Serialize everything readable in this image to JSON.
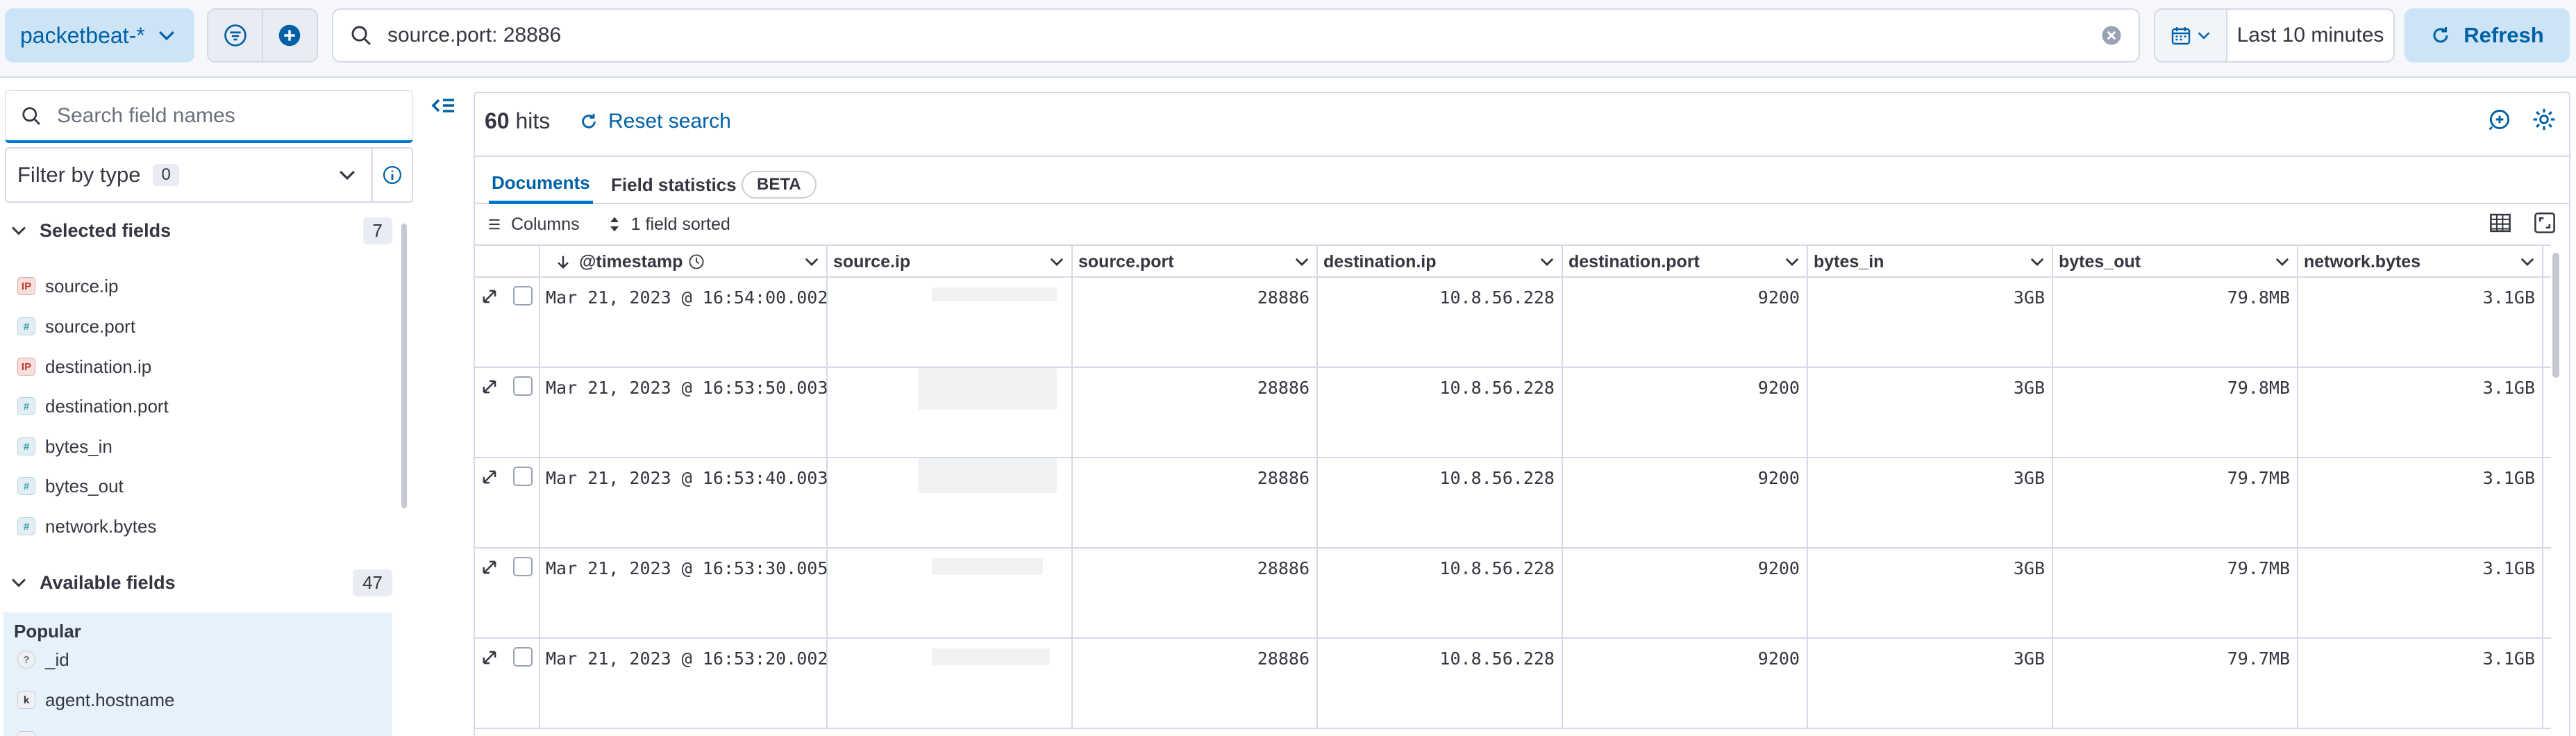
{
  "topbar": {
    "index_pattern": "packetbeat-*",
    "query": "source.port: 28886",
    "time_range": "Last 10 minutes",
    "refresh_label": "Refresh"
  },
  "sidebar": {
    "search_placeholder": "Search field names",
    "filter_by_type_label": "Filter by type",
    "filter_by_type_count": "0",
    "selected_title": "Selected fields",
    "selected_count": "7",
    "selected_fields": [
      {
        "name": "source.ip",
        "type": "ip"
      },
      {
        "name": "source.port",
        "type": "number"
      },
      {
        "name": "destination.ip",
        "type": "ip"
      },
      {
        "name": "destination.port",
        "type": "number"
      },
      {
        "name": "bytes_in",
        "type": "number"
      },
      {
        "name": "bytes_out",
        "type": "number"
      },
      {
        "name": "network.bytes",
        "type": "number"
      }
    ],
    "available_title": "Available fields",
    "available_count": "47",
    "popular_label": "Popular",
    "popular_fields": [
      {
        "name": "_id",
        "type": "unknown"
      },
      {
        "name": "agent.hostname",
        "type": "keyword"
      }
    ]
  },
  "main": {
    "hits_count": "60",
    "hits_label": "hits",
    "reset_label": "Reset search",
    "tabs": [
      "Documents",
      "Field statistics"
    ],
    "beta_badge": "BETA",
    "columns_label": "Columns",
    "sorted_label": "1 field sorted"
  },
  "grid": {
    "columns": [
      "@timestamp",
      "source.ip",
      "source.port",
      "destination.ip",
      "destination.port",
      "bytes_in",
      "bytes_out",
      "network.bytes"
    ],
    "rows": [
      {
        "timestamp": "Mar 21, 2023 @ 16:54:00.002",
        "source_port": "28886",
        "destination_ip": "10.8.56.228",
        "destination_port": "9200",
        "bytes_in": "3GB",
        "bytes_out": "79.8MB",
        "network_bytes": "3.1GB"
      },
      {
        "timestamp": "Mar 21, 2023 @ 16:53:50.003",
        "source_port": "28886",
        "destination_ip": "10.8.56.228",
        "destination_port": "9200",
        "bytes_in": "3GB",
        "bytes_out": "79.8MB",
        "network_bytes": "3.1GB"
      },
      {
        "timestamp": "Mar 21, 2023 @ 16:53:40.003",
        "source_port": "28886",
        "destination_ip": "10.8.56.228",
        "destination_port": "9200",
        "bytes_in": "3GB",
        "bytes_out": "79.7MB",
        "network_bytes": "3.1GB"
      },
      {
        "timestamp": "Mar 21, 2023 @ 16:53:30.005",
        "source_port": "28886",
        "destination_ip": "10.8.56.228",
        "destination_port": "9200",
        "bytes_in": "3GB",
        "bytes_out": "79.7MB",
        "network_bytes": "3.1GB"
      },
      {
        "timestamp": "Mar 21, 2023 @ 16:53:20.002",
        "source_port": "28886",
        "destination_ip": "10.8.56.228",
        "destination_port": "9200",
        "bytes_in": "3GB",
        "bytes_out": "79.7MB",
        "network_bytes": "3.1GB"
      }
    ]
  },
  "colors": {
    "accent": "#0077cc",
    "accent_text": "#0061a6",
    "border": "#d3dae6"
  }
}
